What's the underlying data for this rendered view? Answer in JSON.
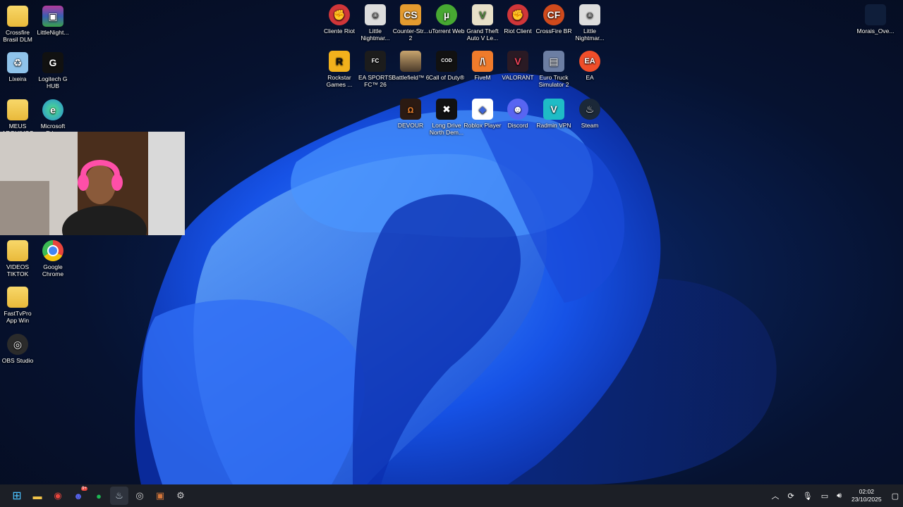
{
  "desktop": {
    "icons_left": [
      {
        "label": "Crossfire Brasil DLM",
        "icon": "folder-icon",
        "color": "#f3c54a"
      },
      {
        "label": "LittleNight...",
        "icon": "winrar-icon",
        "color": "#7a2a8a"
      },
      {
        "label": "Lixeira",
        "icon": "recycle-bin-icon",
        "color": "#6aa9d8"
      },
      {
        "label": "Logitech G HUB",
        "icon": "logitech-icon",
        "color": "#222222"
      },
      {
        "label": "MEUS ARQUIVOS",
        "icon": "folder-icon",
        "color": "#f3c54a"
      },
      {
        "label": "Microsoft Edge",
        "icon": "edge-icon",
        "color": "#2a8fd6"
      },
      {
        "label": "VIDEOS TIKTOK",
        "icon": "folder-icon",
        "color": "#f3c54a"
      },
      {
        "label": "Google Chrome",
        "icon": "chrome-icon",
        "color": "#e8453c"
      },
      {
        "label": "FastTvPro App Win",
        "icon": "folder-icon",
        "color": "#f3c54a"
      },
      {
        "label": "OBS Studio",
        "icon": "obs-icon",
        "color": "#2b2b2b"
      }
    ],
    "icons_top": [
      {
        "label": "Cliente Riot",
        "icon": "riot-icon",
        "color": "#d13639"
      },
      {
        "label": "Little Nightmar...",
        "icon": "little-nightmares-icon",
        "color": "#333333"
      },
      {
        "label": "Counter-Str... 2",
        "icon": "cs2-icon",
        "color": "#e49b2f"
      },
      {
        "label": "uTorrent Web",
        "icon": "utorrent-icon",
        "color": "#47a832"
      },
      {
        "label": "Grand Theft Auto V Le...",
        "icon": "gta-icon",
        "color": "#4f8a3b"
      },
      {
        "label": "Riot Client",
        "icon": "riot-icon",
        "color": "#d13639"
      },
      {
        "label": "CrossFire BR",
        "icon": "crossfire-icon",
        "color": "#d04a1c"
      },
      {
        "label": "Little Nightmar...",
        "icon": "little-nightmares-icon",
        "color": "#333333"
      },
      {
        "label": "Rockstar Games ...",
        "icon": "rockstar-icon",
        "color": "#f2b11c"
      },
      {
        "label": "EA SPORTS FC™ 26",
        "icon": "ea-fc-icon",
        "color": "#1c1c1c"
      },
      {
        "label": "Battlefield™ 6",
        "icon": "battlefield-icon",
        "color": "#7d6a52"
      },
      {
        "label": "Call of Duty®",
        "icon": "cod-icon",
        "color": "#111111"
      },
      {
        "label": "FiveM",
        "icon": "fivem-icon",
        "color": "#f07b2b"
      },
      {
        "label": "VALORANT",
        "icon": "valorant-icon",
        "color": "#f3435a"
      },
      {
        "label": "Euro Truck Simulator 2",
        "icon": "ets2-icon",
        "color": "#6c7ea3"
      },
      {
        "label": "EA",
        "icon": "ea-icon",
        "color": "#f04e2a"
      },
      {
        "label": "DEVOUR",
        "icon": "devour-icon",
        "color": "#2b1a12"
      },
      {
        "label": "Long Drive North Dem...",
        "icon": "long-drive-icon",
        "color": "#111111"
      },
      {
        "label": "Roblox Player",
        "icon": "roblox-icon",
        "color": "#3d64d6"
      },
      {
        "label": "Discord",
        "icon": "discord-icon",
        "color": "#5865f2"
      },
      {
        "label": "Radmin VPN",
        "icon": "radmin-icon",
        "color": "#1fbcc6"
      },
      {
        "label": "Steam",
        "icon": "steam-icon",
        "color": "#1b2838"
      }
    ],
    "icon_right": {
      "label": "Morais_Ove...",
      "icon": "file-icon",
      "color": "#1f3a66"
    }
  },
  "taskbar": {
    "items": [
      {
        "name": "start-button",
        "icon": "windows-icon",
        "glyph": "⊞",
        "color": "#4cc2ff"
      },
      {
        "name": "file-explorer",
        "icon": "folder-icon",
        "glyph": "▬",
        "color": "#f3c54a"
      },
      {
        "name": "chrome",
        "icon": "chrome-icon",
        "glyph": "◉",
        "color": "#e8453c"
      },
      {
        "name": "discord",
        "icon": "discord-icon",
        "glyph": "☻",
        "color": "#5865f2"
      },
      {
        "name": "spotify",
        "icon": "spotify-icon",
        "glyph": "●",
        "color": "#1db954"
      },
      {
        "name": "steam",
        "icon": "steam-icon",
        "glyph": "♨",
        "color": "#c7d5e0"
      },
      {
        "name": "obs",
        "icon": "obs-icon",
        "glyph": "◎",
        "color": "#cccccc"
      },
      {
        "name": "winrar",
        "icon": "winrar-icon",
        "glyph": "▣",
        "color": "#d5773a"
      },
      {
        "name": "settings",
        "icon": "gear-icon",
        "glyph": "⚙",
        "color": "#cccccc"
      }
    ],
    "discord_badge": "9+",
    "tray": {
      "time": "02:02",
      "date": "23/10/2025"
    }
  }
}
